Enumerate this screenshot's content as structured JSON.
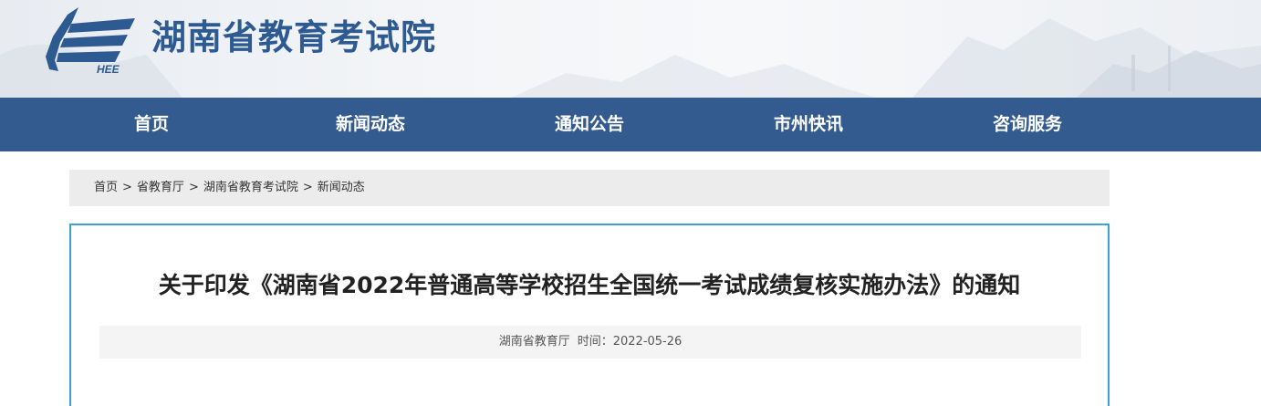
{
  "header": {
    "logo_text": "HEE",
    "site_title": "湖南省教育考试院"
  },
  "nav": {
    "items": [
      {
        "label": "首页"
      },
      {
        "label": "新闻动态"
      },
      {
        "label": "通知公告"
      },
      {
        "label": "市州快讯"
      },
      {
        "label": "咨询服务"
      }
    ]
  },
  "breadcrumb": {
    "items": [
      "首页",
      "省教育厅",
      "湖南省教育考试院",
      "新闻动态"
    ],
    "separator": ">"
  },
  "article": {
    "title": "关于印发《湖南省2022年普通高等学校招生全国统一考试成绩复核实施办法》的通知",
    "source": "湖南省教育厅",
    "time_label": "时间：",
    "date": "2022-05-26"
  },
  "colors": {
    "brand_blue": "#345b8f",
    "title_blue": "#2e5a92",
    "border_cyan": "#3aa3d2"
  }
}
